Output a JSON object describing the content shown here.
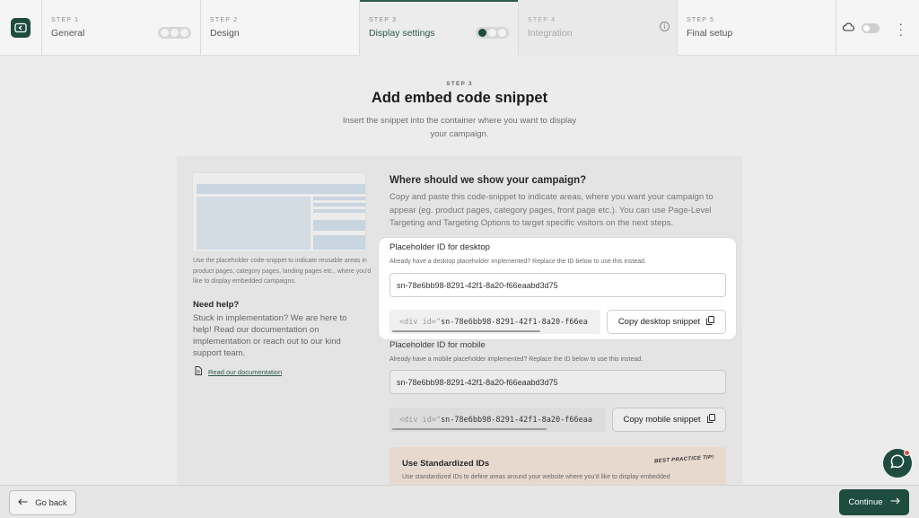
{
  "stepper": {
    "steps": [
      {
        "num": "STEP 1",
        "name": "General"
      },
      {
        "num": "STEP 2",
        "name": "Design"
      },
      {
        "num": "STEP 3",
        "name": "Display settings"
      },
      {
        "num": "STEP 4",
        "name": "Integration"
      },
      {
        "num": "STEP 5",
        "name": "Final setup"
      }
    ]
  },
  "header": {
    "kicker": "STEP 3",
    "title": "Add embed code snippet",
    "subtitle": "Insert the snippet into the container where you want to display your campaign."
  },
  "aside": {
    "preview_caption": "Use the placeholder code-snippet to indicate reusable areas in product pages, category pages, landing pages etc., where you'd like to display embedded campaigns.",
    "help_title": "Need help?",
    "help_text": "Stuck in implementation? We are here to help! Read our documentation on implementation or reach out to our kind support team.",
    "doc_link": "Read our documentation"
  },
  "main": {
    "title": "Where should we show your campaign?",
    "description": "Copy and paste this code-snippet to indicate areas, where you want your campaign to appear (eg. product pages, category pages, front page etc.). You can use Page-Level Targeting and Targeting Options to target specific visitors on the next steps.",
    "desktop": {
      "label": "Placeholder ID for desktop",
      "hint": "Already have a desktop placeholder implemented? Replace the ID below to use this instead.",
      "value": "sn-78e6bb98-8291-42f1-8a20-f66eaabd3d75",
      "snippet_tag": "<div id=\"",
      "snippet_id": "sn-78e6bb98-8291-42f1-8a20-f66ea",
      "copy_label": "Copy desktop snippet"
    },
    "mobile": {
      "label": "Placeholder ID for mobile",
      "hint": "Already have a mobile placeholder implemented? Replace the ID below to use this instead.",
      "value": "sn-78e6bb98-8291-42f1-8a20-f66eaabd3d75",
      "snippet_tag": "<div id=\"",
      "snippet_id": "sn-78e6bb98-8291-42f1-8a20-f66eaa",
      "copy_label": "Copy mobile snippet"
    },
    "tip": {
      "title": "Use Standardized IDs",
      "badge": "BEST PRACTICE TIP!",
      "text": "Use standardized IDs to define areas around your website where you'd like to display embedded"
    }
  },
  "footer": {
    "back_label": "Go back",
    "continue_label": "Continue"
  },
  "colors": {
    "brand": "#1e4d40",
    "notification": "#e34b4b"
  }
}
